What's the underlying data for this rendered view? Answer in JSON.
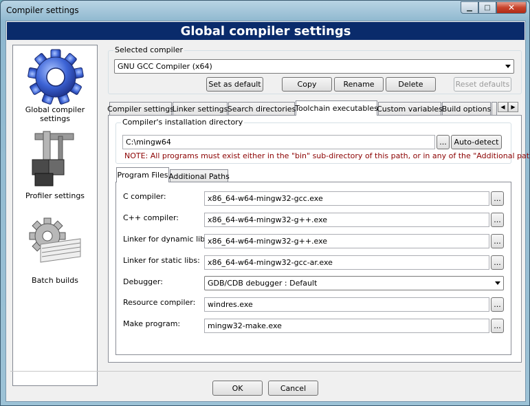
{
  "window": {
    "title": "Compiler settings",
    "min": "▁",
    "max": "□",
    "close": "✕"
  },
  "banner": "Global compiler settings",
  "sidebar": {
    "items": [
      {
        "label": "Global compiler settings",
        "icon": "gear-icon"
      },
      {
        "label": "Profiler settings",
        "icon": "profiler-icon"
      },
      {
        "label": "Batch builds",
        "icon": "batch-builds-icon"
      }
    ]
  },
  "selected_compiler": {
    "label": "Selected compiler",
    "value": "GNU GCC Compiler (x64)",
    "buttons": {
      "set_default": "Set as default",
      "copy": "Copy",
      "rename": "Rename",
      "delete": "Delete",
      "reset": "Reset defaults"
    }
  },
  "tabs": [
    "Compiler settings",
    "Linker settings",
    "Search directories",
    "Toolchain executables",
    "Custom variables",
    "Build options",
    ""
  ],
  "install_dir": {
    "label": "Compiler's installation directory",
    "value": "C:\\mingw64",
    "browse": "...",
    "auto_detect": "Auto-detect",
    "note": "NOTE: All programs must exist either in the \"bin\" sub-directory of this path, or in any of the \"Additional paths\"..."
  },
  "inner_tabs": [
    "Program Files",
    "Additional Paths"
  ],
  "programs": [
    {
      "label": "C compiler:",
      "value": "x86_64-w64-mingw32-gcc.exe"
    },
    {
      "label": "C++ compiler:",
      "value": "x86_64-w64-mingw32-g++.exe"
    },
    {
      "label": "Linker for dynamic libs:",
      "value": "x86_64-w64-mingw32-g++.exe"
    },
    {
      "label": "Linker for static libs:",
      "value": "x86_64-w64-mingw32-gcc-ar.exe"
    },
    {
      "label": "Debugger:",
      "value": "GDB/CDB debugger : Default"
    },
    {
      "label": "Resource compiler:",
      "value": "windres.exe"
    },
    {
      "label": "Make program:",
      "value": "mingw32-make.exe"
    }
  ],
  "browse_label": "...",
  "footer": {
    "ok": "OK",
    "cancel": "Cancel"
  }
}
